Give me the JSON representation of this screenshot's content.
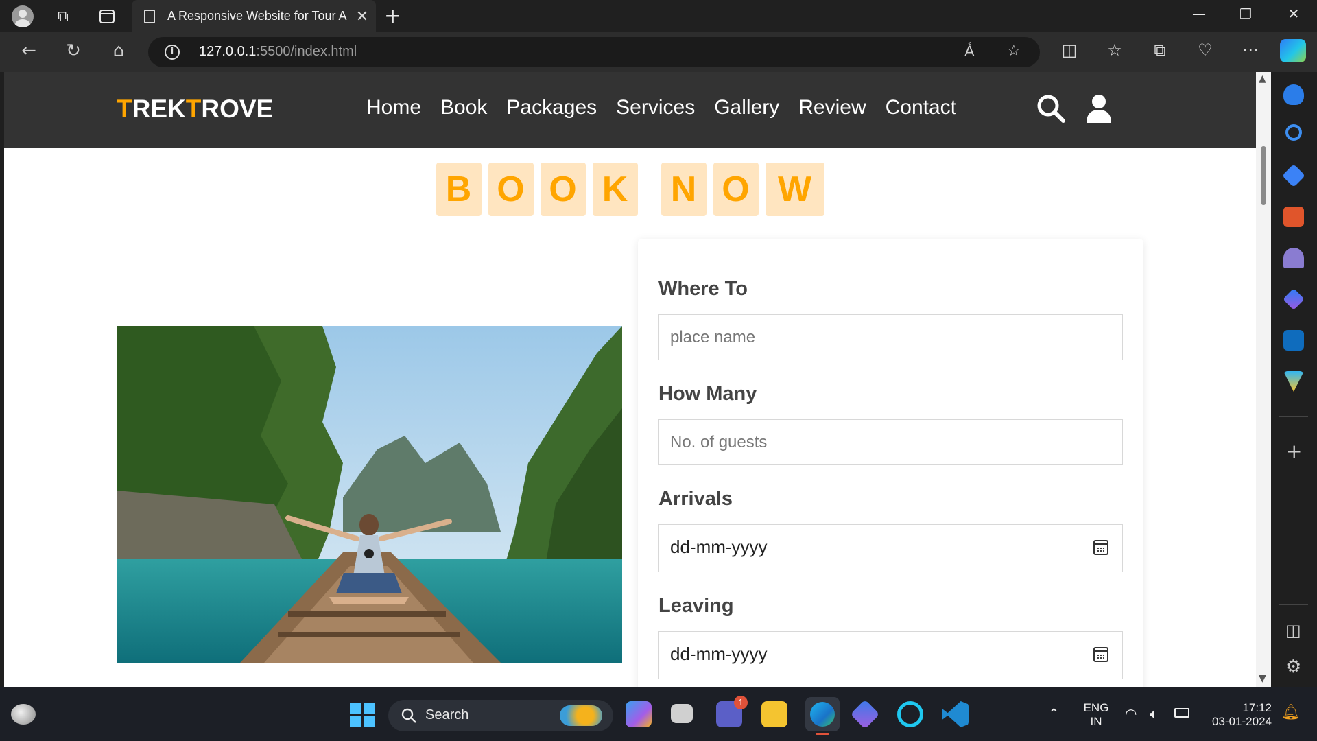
{
  "browser": {
    "tab_title": "A Responsive Website for Tour A",
    "tab_close": "✕",
    "new_tab": "+",
    "url_host": "127.0.0.1",
    "url_path": ":5500/index.html"
  },
  "site": {
    "logo_t1": "T",
    "logo_r1": "REK",
    "logo_t2": "T",
    "logo_r2": "ROVE",
    "nav": [
      "Home",
      "Book",
      "Packages",
      "Services",
      "Gallery",
      "Review",
      "Contact"
    ],
    "heading_word1": [
      "B",
      "O",
      "O",
      "K"
    ],
    "heading_word2": [
      "N",
      "O",
      "W"
    ]
  },
  "form": {
    "where_label": "Where To",
    "where_placeholder": "place name",
    "howmany_label": "How Many",
    "howmany_placeholder": "No. of guests",
    "arrivals_label": "Arrivals",
    "arrivals_value": "dd-mm-yyyy",
    "leaving_label": "Leaving",
    "leaving_value": "dd-mm-yyyy"
  },
  "taskbar": {
    "search_label": "Search",
    "chat_badge": "1",
    "lang": "ENG",
    "region": "IN",
    "time": "17:12",
    "date": "03-01-2024"
  },
  "colors": {
    "accent": "#ffa500",
    "header_bg": "#333333",
    "letter_bg": "#ffe5c0"
  }
}
